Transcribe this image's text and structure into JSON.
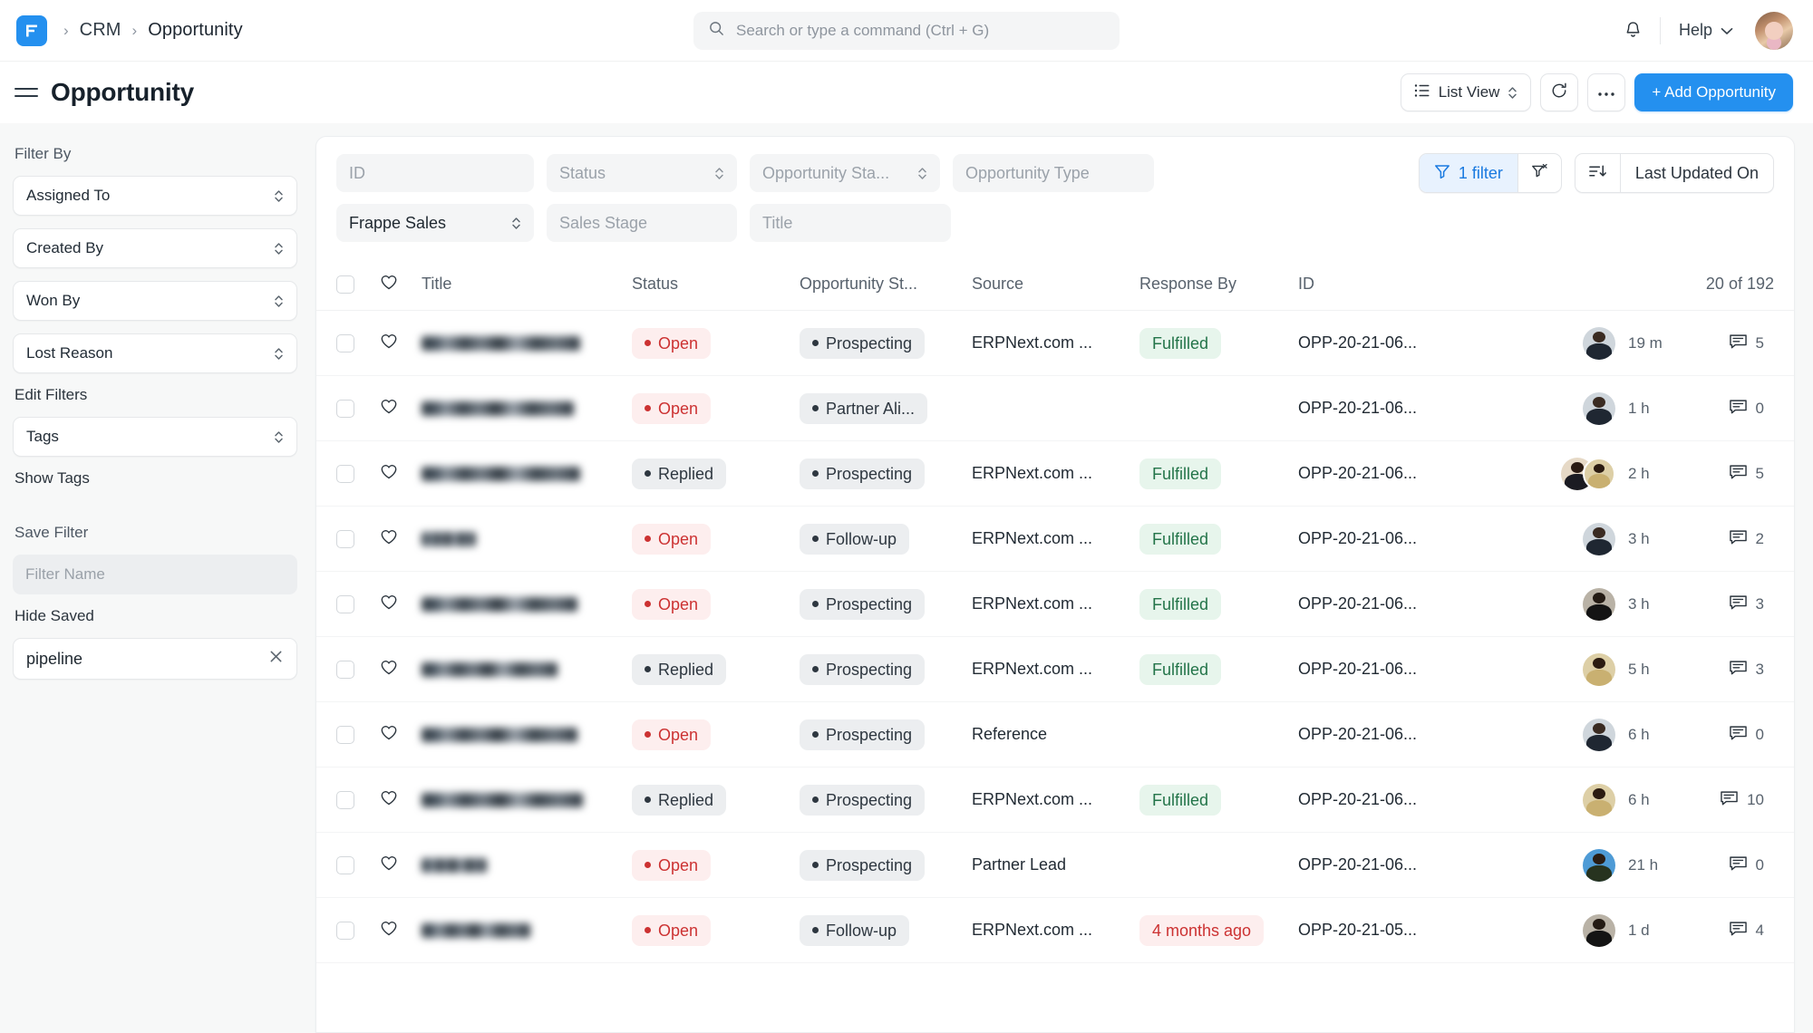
{
  "topbar": {
    "logo_name": "frappe-logo",
    "breadcrumbs": [
      "CRM",
      "Opportunity"
    ],
    "search_placeholder": "Search or type a command (Ctrl + G)",
    "bell_label": "Notifications",
    "help_label": "Help"
  },
  "page": {
    "title": "Opportunity",
    "view_button": "List View",
    "refresh_label": "Refresh",
    "more_label": "…",
    "add_button": "+ Add Opportunity"
  },
  "sidebar": {
    "filter_by_label": "Filter By",
    "filters": [
      {
        "label": "Assigned To"
      },
      {
        "label": "Created By"
      },
      {
        "label": "Won By"
      },
      {
        "label": "Lost Reason"
      }
    ],
    "edit_filters_label": "Edit Filters",
    "tags_label": "Tags",
    "show_tags_label": "Show Tags",
    "save_filter_label": "Save Filter",
    "filter_name_placeholder": "Filter Name",
    "hide_saved_label": "Hide Saved",
    "saved_filter": "pipeline"
  },
  "filterbar": {
    "row1": [
      {
        "placeholder": "ID",
        "value": "",
        "select": false
      },
      {
        "placeholder": "Status",
        "value": "",
        "select": true
      },
      {
        "placeholder": "Opportunity Sta...",
        "value": "",
        "select": true
      },
      {
        "placeholder": "Opportunity Type",
        "value": "",
        "select": false
      }
    ],
    "row2": [
      {
        "placeholder": "Frappe Sales",
        "value": "Frappe Sales",
        "select": true
      },
      {
        "placeholder": "Sales Stage",
        "value": "",
        "select": false
      },
      {
        "placeholder": "Title",
        "value": "",
        "select": false
      }
    ],
    "filter_count_label": "1 filter",
    "clear_filter_label": "clear-filter",
    "sort_label": "Last Updated On"
  },
  "table": {
    "columns": [
      "Title",
      "Status",
      "Opportunity St...",
      "Source",
      "Response By",
      "ID"
    ],
    "count_label": "20 of 192",
    "rows": [
      {
        "title": "",
        "status": "Open",
        "status_kind": "open",
        "stage": "Prospecting",
        "source": "ERPNext.com ...",
        "response": "Fulfilled",
        "response_kind": "fulfilled",
        "id": "OPP-20-21-06...",
        "avatars": 1,
        "avatar_style": "m1",
        "time": "19 m",
        "comments": "5"
      },
      {
        "title": "",
        "status": "Open",
        "status_kind": "open",
        "stage": "Partner Ali...",
        "source": "",
        "response": "",
        "response_kind": "",
        "id": "OPP-20-21-06...",
        "avatars": 1,
        "avatar_style": "m1",
        "time": "1 h",
        "comments": "0"
      },
      {
        "title": "",
        "status": "Replied",
        "status_kind": "replied",
        "stage": "Prospecting",
        "source": "ERPNext.com ...",
        "response": "Fulfilled",
        "response_kind": "fulfilled",
        "id": "OPP-20-21-06...",
        "avatars": 2,
        "avatar_style": "f1",
        "time": "2 h",
        "comments": "5"
      },
      {
        "title": "",
        "status": "Open",
        "status_kind": "open",
        "stage": "Follow-up",
        "source": "ERPNext.com ...",
        "response": "Fulfilled",
        "response_kind": "fulfilled",
        "id": "OPP-20-21-06...",
        "avatars": 1,
        "avatar_style": "m1",
        "time": "3 h",
        "comments": "2"
      },
      {
        "title": "",
        "status": "Open",
        "status_kind": "open",
        "stage": "Prospecting",
        "source": "ERPNext.com ...",
        "response": "Fulfilled",
        "response_kind": "fulfilled",
        "id": "OPP-20-21-06...",
        "avatars": 1,
        "avatar_style": "m2",
        "time": "3 h",
        "comments": "3"
      },
      {
        "title": "",
        "status": "Replied",
        "status_kind": "replied",
        "stage": "Prospecting",
        "source": "ERPNext.com ...",
        "response": "Fulfilled",
        "response_kind": "fulfilled",
        "id": "OPP-20-21-06...",
        "avatars": 1,
        "avatar_style": "f2",
        "time": "5 h",
        "comments": "3"
      },
      {
        "title": "",
        "status": "Open",
        "status_kind": "open",
        "stage": "Prospecting",
        "source": "Reference",
        "response": "",
        "response_kind": "",
        "id": "OPP-20-21-06...",
        "avatars": 1,
        "avatar_style": "m1",
        "time": "6 h",
        "comments": "0"
      },
      {
        "title": "",
        "status": "Replied",
        "status_kind": "replied",
        "stage": "Prospecting",
        "source": "ERPNext.com ...",
        "response": "Fulfilled",
        "response_kind": "fulfilled",
        "id": "OPP-20-21-06...",
        "avatars": 1,
        "avatar_style": "f2",
        "time": "6 h",
        "comments": "10"
      },
      {
        "title": "",
        "status": "Open",
        "status_kind": "open",
        "stage": "Prospecting",
        "source": "Partner Lead",
        "response": "",
        "response_kind": "",
        "id": "OPP-20-21-06...",
        "avatars": 1,
        "avatar_style": "m3",
        "time": "21 h",
        "comments": "0"
      },
      {
        "title": "",
        "status": "Open",
        "status_kind": "open",
        "stage": "Follow-up",
        "source": "ERPNext.com ...",
        "response": "4 months ago",
        "response_kind": "overdue",
        "id": "OPP-20-21-05...",
        "avatars": 1,
        "avatar_style": "m2",
        "time": "1 d",
        "comments": "4"
      }
    ],
    "redaction_widths": [
      175,
      168,
      175,
      60,
      172,
      150,
      172,
      178,
      72,
      120
    ]
  },
  "colors": {
    "accent": "#2490ef",
    "open": "#cc3232",
    "fulfilled": "#237449",
    "neutral": "#2e3740"
  }
}
